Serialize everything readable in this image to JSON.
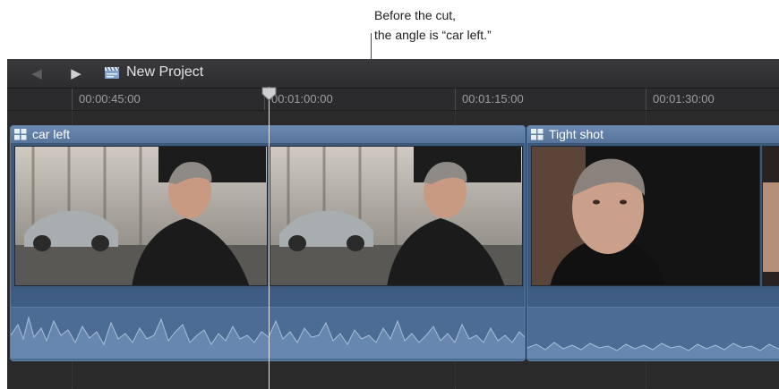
{
  "callout": {
    "line1": "Before the cut,",
    "line2": "the angle is “car left.”"
  },
  "toolbar": {
    "back_icon": "back-arrow-icon",
    "forward_icon": "play-forward-icon",
    "project_icon": "clapperboard-icon",
    "project_title": "New Project"
  },
  "ruler": {
    "timecodes": [
      "00:00:45:00",
      "00:01:00:00",
      "00:01:15:00",
      "00:01:30:00"
    ]
  },
  "clips": [
    {
      "name": "car left",
      "icon": "multicam-clip-icon"
    },
    {
      "name": "Tight shot",
      "icon": "multicam-clip-icon"
    }
  ],
  "colors": {
    "clip_body": "#4c6b95",
    "clip_header": "#6b89b2",
    "timeline_bg": "#2e2e2f",
    "playhead": "#e6e6e8"
  }
}
